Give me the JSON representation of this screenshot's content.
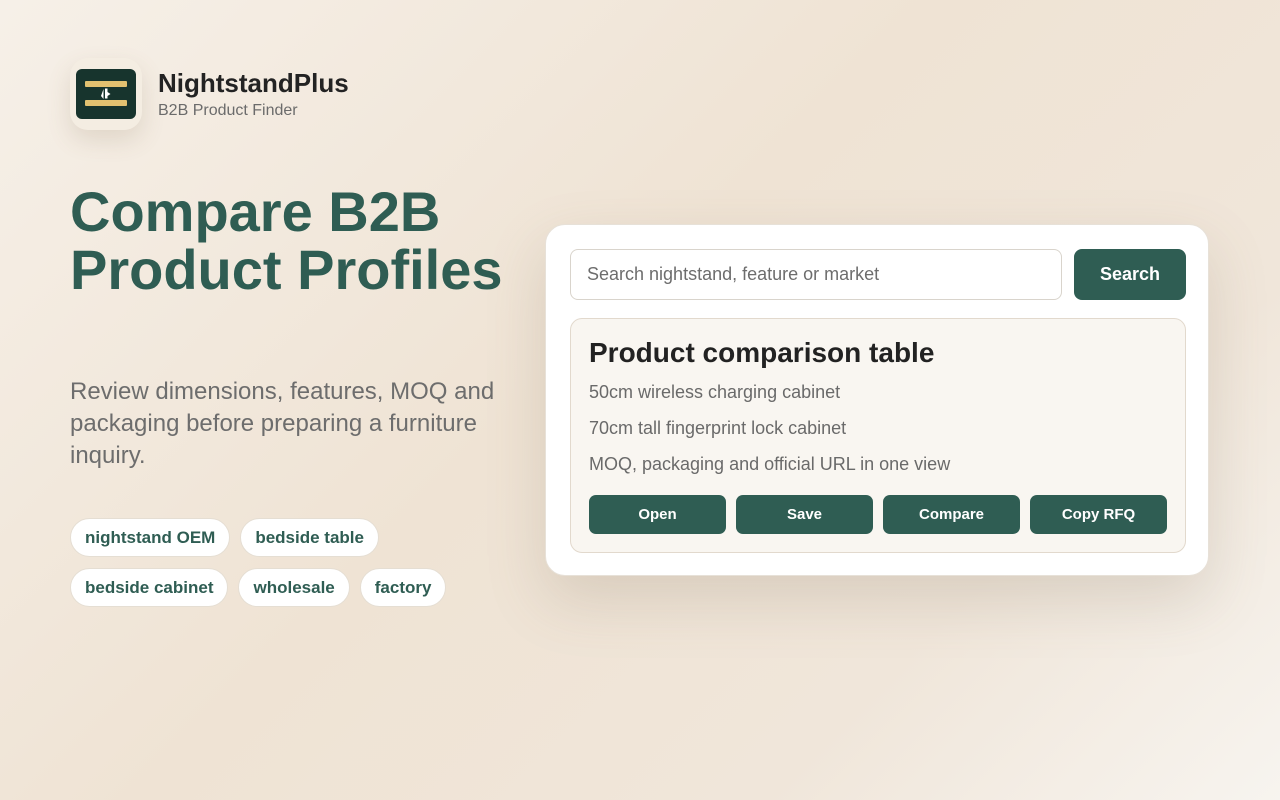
{
  "brand": {
    "name": "NightstandPlus",
    "subtitle": "B2B Product Finder",
    "colors": {
      "logo_bg": "#17342d",
      "logo_stripe": "#e2c170"
    }
  },
  "hero": {
    "title": "Compare B2B Product Profiles",
    "subtitle": "Review dimensions, features, MOQ and packaging before preparing a furniture inquiry."
  },
  "tags": [
    "nightstand OEM",
    "bedside table",
    "bedside cabinet",
    "wholesale",
    "factory"
  ],
  "search": {
    "placeholder": "Search nightstand, feature or market",
    "value": "",
    "button_label": "Search"
  },
  "card": {
    "title": "Product comparison table",
    "features": [
      "50cm wireless charging cabinet",
      "70cm tall fingerprint lock cabinet",
      "MOQ, packaging and official URL in one view"
    ],
    "actions": [
      "Open",
      "Save",
      "Compare",
      "Copy RFQ"
    ]
  },
  "colors": {
    "accent": "#2f5d53",
    "panel_bg": "#ffffff",
    "card_bg": "#f9f6f1"
  }
}
